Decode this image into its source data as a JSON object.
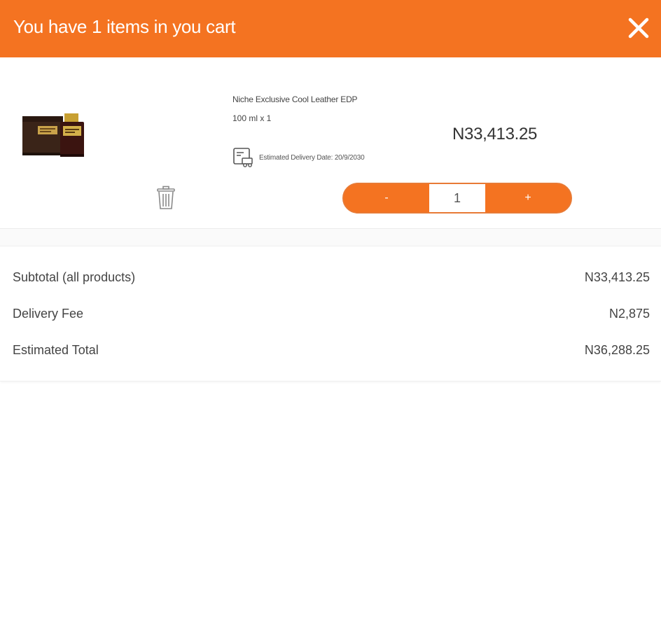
{
  "header": {
    "title": "You have 1 items in you cart",
    "background_color": "#f47321"
  },
  "close_icon": "close-icon",
  "cart_item": {
    "name": "Niche Exclusive Cool Leather EDP",
    "variant": "100 ml x 1",
    "delivery_text": "Estimated Delivery Date: 20/9/2030",
    "delivery_icon": "delivery-calendar-icon",
    "price": "N33,413.25",
    "quantity": "1",
    "minus_label": "-",
    "plus_label": "+",
    "trash_icon": "trash-icon"
  },
  "summary": {
    "rows": [
      {
        "label": "Subtotal (all products)",
        "value": "N33,413.25"
      },
      {
        "label": "Delivery Fee",
        "value": "N2,875"
      },
      {
        "label": "Estimated Total",
        "value": "N36,288.25"
      }
    ]
  },
  "accent_color": "#f47321"
}
